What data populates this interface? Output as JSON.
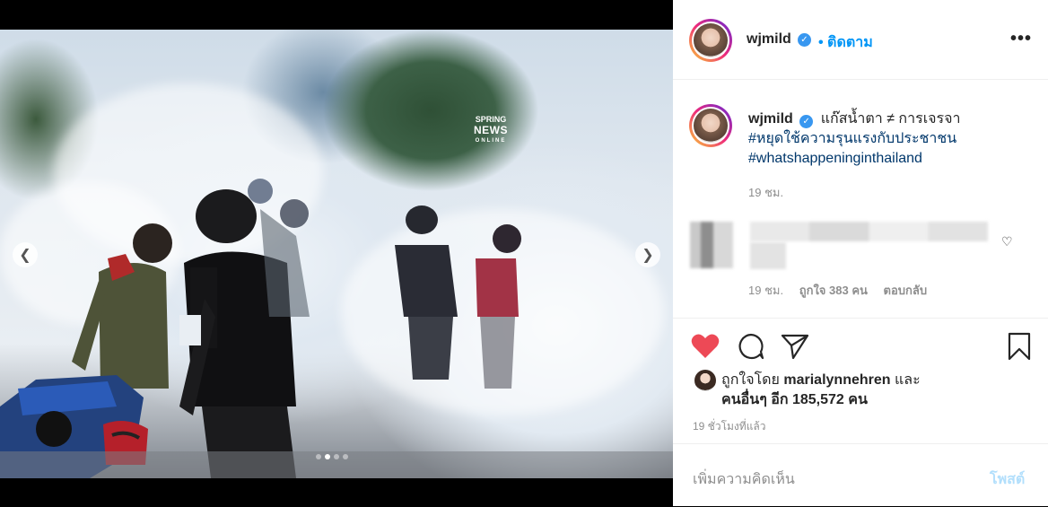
{
  "post": {
    "username": "wjmild",
    "follow_label": "• ติดตาม",
    "more_icon": "more-options-icon"
  },
  "media": {
    "watermark_top": "SPRING",
    "watermark_main": "NEWS",
    "watermark_sub": "ONLINE",
    "carousel_total": 4,
    "carousel_active": 2
  },
  "caption": {
    "username": "wjmild",
    "text": "แก๊สน้ำตา ≠ การเจรจา",
    "hashtags": [
      "#หยุดใช้ความรุนแรงกับประชาชน",
      "#whatshappeninginthailand"
    ],
    "time": "19 ชม."
  },
  "comment": {
    "time": "19 ชม.",
    "likes": "ถูกใจ 383 คน",
    "reply": "ตอบกลับ"
  },
  "likes": {
    "prefix": "ถูกใจโดย ",
    "user": "marialynnehren",
    "mid": " และ",
    "others": "คนอื่นๆ อีก 185,572 คน"
  },
  "ago": "19 ชั่วโมงที่แล้ว",
  "add_comment": {
    "placeholder": "เพิ่มความคิดเห็น",
    "post_label": "โพสต์"
  },
  "colors": {
    "accent": "#0095f6",
    "like_red": "#ed4956",
    "verified": "#3897f0"
  }
}
